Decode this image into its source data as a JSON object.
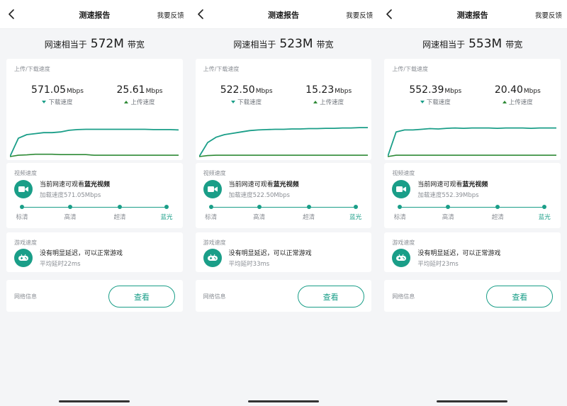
{
  "screens": [
    {
      "nav": {
        "title": "测速报告",
        "feedback": "我要反馈"
      },
      "summary": {
        "prefix": "网速相当于",
        "value": "572M",
        "suffix": "带宽"
      },
      "speed": {
        "section_label": "上传/下载速度",
        "download": {
          "value": "571.05",
          "unit": "Mbps",
          "label": "下载速度"
        },
        "upload": {
          "value": "25.61",
          "unit": "Mbps",
          "label": "上传速度"
        },
        "download_curve": [
          0.0,
          0.55,
          0.66,
          0.69,
          0.72,
          0.72,
          0.74,
          0.79,
          0.81,
          0.82,
          0.82,
          0.82,
          0.82,
          0.82,
          0.82,
          0.82,
          0.82,
          0.81,
          0.81,
          0.81,
          0.8
        ],
        "upload_curve": [
          0.0,
          0.04,
          0.05,
          0.07,
          0.07,
          0.07,
          0.06,
          0.06,
          0.06,
          0.06,
          0.04,
          0.04,
          0.04,
          0.04,
          0.04,
          0.04,
          0.04,
          0.04,
          0.04,
          0.04,
          0.04
        ]
      },
      "video": {
        "section_label": "视频速度",
        "main_prefix": "当前网速可观看",
        "main_highlight": "蓝光视频",
        "sub": "加载速度571.05Mbps",
        "levels": [
          "标清",
          "高清",
          "超清",
          "蓝光"
        ],
        "active_level": 3
      },
      "game": {
        "section_label": "游戏速度",
        "main": "没有明显延迟，可以正常游戏",
        "sub": "平均延时22ms"
      },
      "network": {
        "label": "网络信息",
        "button": "查看"
      }
    },
    {
      "nav": {
        "title": "测速报告",
        "feedback": "我要反馈"
      },
      "summary": {
        "prefix": "网速相当于",
        "value": "523M",
        "suffix": "带宽"
      },
      "speed": {
        "section_label": "上传/下载速度",
        "download": {
          "value": "522.50",
          "unit": "Mbps",
          "label": "下载速度"
        },
        "upload": {
          "value": "15.23",
          "unit": "Mbps",
          "label": "上传速度"
        },
        "download_curve": [
          0.0,
          0.42,
          0.58,
          0.66,
          0.7,
          0.74,
          0.78,
          0.8,
          0.81,
          0.82,
          0.82,
          0.83,
          0.83,
          0.84,
          0.84,
          0.85,
          0.85,
          0.86,
          0.86,
          0.87,
          0.87
        ],
        "upload_curve": [
          0.0,
          0.03,
          0.04,
          0.04,
          0.04,
          0.04,
          0.04,
          0.04,
          0.04,
          0.04,
          0.04,
          0.04,
          0.04,
          0.04,
          0.04,
          0.04,
          0.04,
          0.04,
          0.04,
          0.04,
          0.04
        ]
      },
      "video": {
        "section_label": "视频速度",
        "main_prefix": "当前网速可观看",
        "main_highlight": "蓝光视频",
        "sub": "加载速度522.50Mbps",
        "levels": [
          "标清",
          "高清",
          "超清",
          "蓝光"
        ],
        "active_level": 3
      },
      "game": {
        "section_label": "游戏速度",
        "main": "没有明显延迟，可以正常游戏",
        "sub": "平均延时33ms"
      },
      "network": {
        "label": "网络信息",
        "button": "查看"
      }
    },
    {
      "nav": {
        "title": "测速报告",
        "feedback": "我要反馈"
      },
      "summary": {
        "prefix": "网速相当于",
        "value": "553M",
        "suffix": "带宽"
      },
      "speed": {
        "section_label": "上传/下载速度",
        "download": {
          "value": "552.39",
          "unit": "Mbps",
          "label": "下载速度"
        },
        "upload": {
          "value": "20.40",
          "unit": "Mbps",
          "label": "上传速度"
        },
        "download_curve": [
          0.0,
          0.74,
          0.8,
          0.8,
          0.82,
          0.84,
          0.83,
          0.85,
          0.86,
          0.85,
          0.86,
          0.86,
          0.86,
          0.85,
          0.86,
          0.86,
          0.86,
          0.85,
          0.86,
          0.86,
          0.86
        ],
        "upload_curve": [
          0.0,
          0.04,
          0.04,
          0.04,
          0.04,
          0.04,
          0.04,
          0.04,
          0.04,
          0.04,
          0.04,
          0.04,
          0.04,
          0.04,
          0.04,
          0.04,
          0.04,
          0.04,
          0.04,
          0.04,
          0.04
        ]
      },
      "video": {
        "section_label": "视频速度",
        "main_prefix": "当前网速可观看",
        "main_highlight": "蓝光视频",
        "sub": "加载速度552.39Mbps",
        "levels": [
          "标清",
          "高清",
          "超清",
          "蓝光"
        ],
        "active_level": 3
      },
      "game": {
        "section_label": "游戏速度",
        "main": "没有明显延迟，可以正常游戏",
        "sub": "平均延时23ms"
      },
      "network": {
        "label": "网络信息",
        "button": "查看"
      }
    }
  ],
  "colors": {
    "accent": "#1a9e88",
    "upload": "#2e8a36"
  }
}
